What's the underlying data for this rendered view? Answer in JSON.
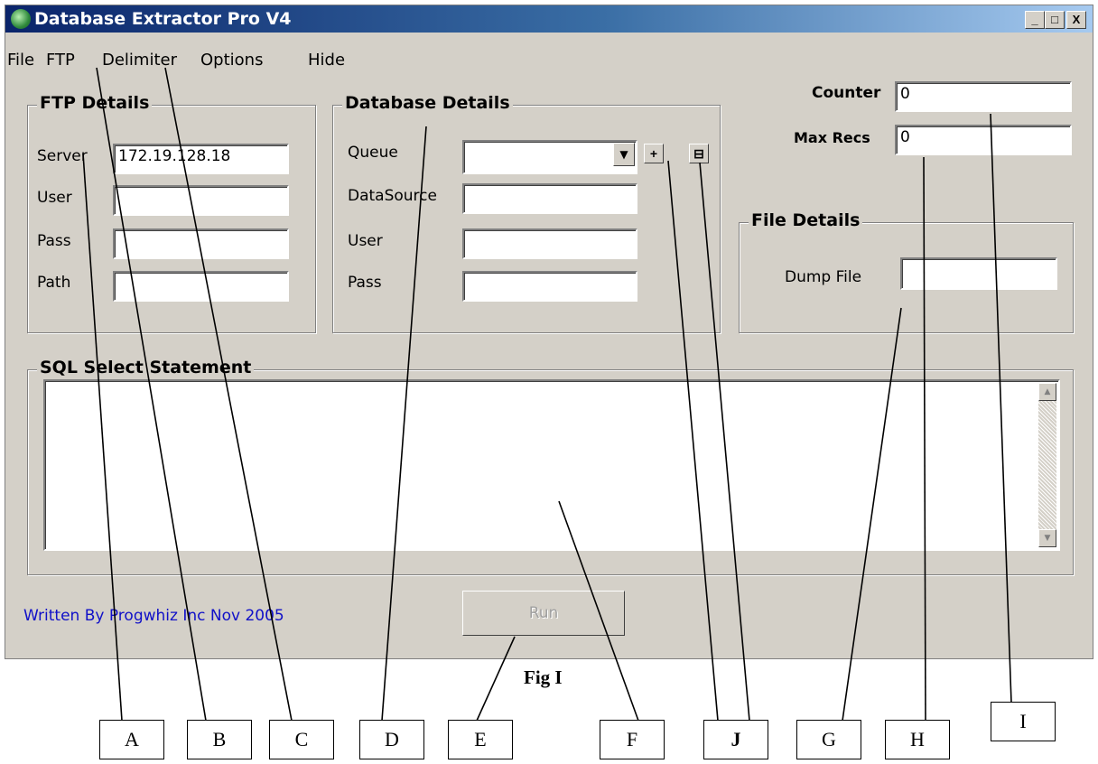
{
  "window": {
    "title": "Database Extractor Pro V4",
    "buttons": [
      "_",
      "□",
      "X"
    ]
  },
  "menu": [
    "File",
    "FTP",
    "Delimiter",
    "Options",
    "Hide"
  ],
  "ftp": {
    "title": "FTP Details",
    "server_label": "Server",
    "server_value": "172.19.128.18",
    "user_label": "User",
    "pass_label": "Pass",
    "path_label": "Path"
  },
  "db": {
    "title": "Database Details",
    "queue_label": "Queue",
    "datasource_label": "DataSource",
    "user_label": "User",
    "pass_label": "Pass",
    "add_btn": "+",
    "remove_btn": "⊟"
  },
  "counters": {
    "counter_label": "Counter",
    "counter_value": "0",
    "maxrecs_label": "Max Recs",
    "maxrecs_value": "0"
  },
  "file": {
    "title": "File Details",
    "dump_label": "Dump File"
  },
  "sql": {
    "title": "SQL Select Statement"
  },
  "credit": "Written By Progwhiz Inc Nov 2005",
  "run_label": "Run",
  "figure_caption": "Fig I",
  "callouts": [
    "A",
    "B",
    "C",
    "D",
    "E",
    "F",
    "J",
    "G",
    "H",
    "I"
  ]
}
